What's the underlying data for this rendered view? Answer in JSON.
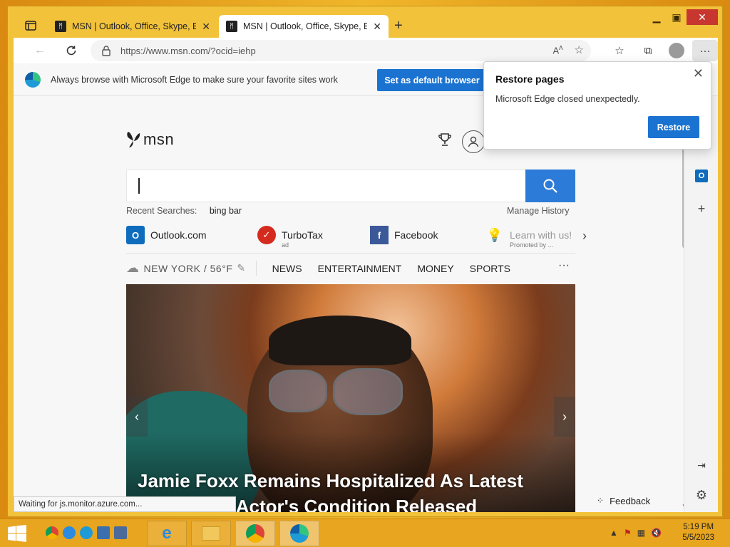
{
  "browser": {
    "tabs": [
      {
        "title": "MSN | Outlook, Office, Skype, Bin",
        "active": false
      },
      {
        "title": "MSN | Outlook, Office, Skype, Bin",
        "active": true
      }
    ],
    "address": {
      "url": "https://www.msn.com/?ocid=iehp"
    },
    "infobar": {
      "message": "Always browse with Microsoft Edge to make sure your favorite sites work",
      "button": "Set as default browser"
    },
    "status_text": "Waiting for js.monitor.azure.com..."
  },
  "popup": {
    "title": "Restore pages",
    "message": "Microsoft Edge closed unexpectedly.",
    "button": "Restore"
  },
  "msn": {
    "logo": "msn",
    "recent_label": "Recent Searches:",
    "recent_term": "bing bar",
    "manage_history": "Manage History",
    "quicklinks": [
      {
        "label": "Outlook.com",
        "icon": "outlook-icon",
        "ad": ""
      },
      {
        "label": "TurboTax",
        "icon": "turbotax-icon",
        "ad": "ad"
      },
      {
        "label": "Facebook",
        "icon": "facebook-icon",
        "ad": ""
      },
      {
        "label": "Learn with us!",
        "icon": "lightbulb-icon",
        "ad": "Promoted by ..."
      }
    ],
    "weather": "NEW YORK / 56°F",
    "nav": [
      "NEWS",
      "ENTERTAINMENT",
      "MONEY",
      "SPORTS"
    ],
    "headline": "Jamie Foxx Remains Hospitalized As Latest Update On Actor's Condition Released",
    "feedback": "Feedback"
  },
  "taskbar": {
    "time": "5:19 PM",
    "date": "5/5/2023"
  },
  "colors": {
    "accent": "#1b73d1",
    "search": "#2d7bd8",
    "desktop": "#e8a51f"
  }
}
